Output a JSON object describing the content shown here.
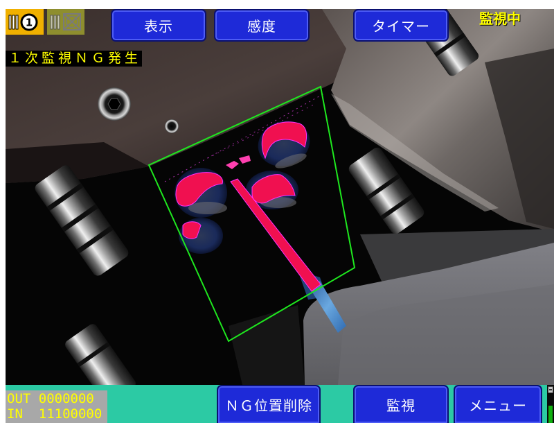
{
  "camera_selector": {
    "camera1": {
      "icon": "camera-1-icon",
      "number": "1",
      "bg": "#f0b000"
    },
    "camera2": {
      "icon": "camera-2-disabled-icon",
      "bg": "#8e8e2e"
    }
  },
  "toolbar": {
    "display_label": "表示",
    "sensitivity_label": "感度",
    "timer_label": "タイマー"
  },
  "status": {
    "mode": "監視中",
    "alert": "１次監視ＮＧ発生"
  },
  "counters": {
    "out_label": "OUT",
    "out_value": "0000000",
    "in_label": "IN",
    "in_value": "11100000"
  },
  "footer": {
    "ng_clear_label": "ＮＧ位置削除",
    "monitor_label": "監視",
    "menu_label": "メニュー",
    "indicator_icon": "status-indicator-icon"
  },
  "colors": {
    "button_blue": "#1e2ad8",
    "bottom_bar": "#2ccaa4",
    "alert_yellow": "#ffff00",
    "counter_bg": "#a8a8a8",
    "detection_area": "#1ee81e",
    "ng_overlay": "#f01050"
  }
}
